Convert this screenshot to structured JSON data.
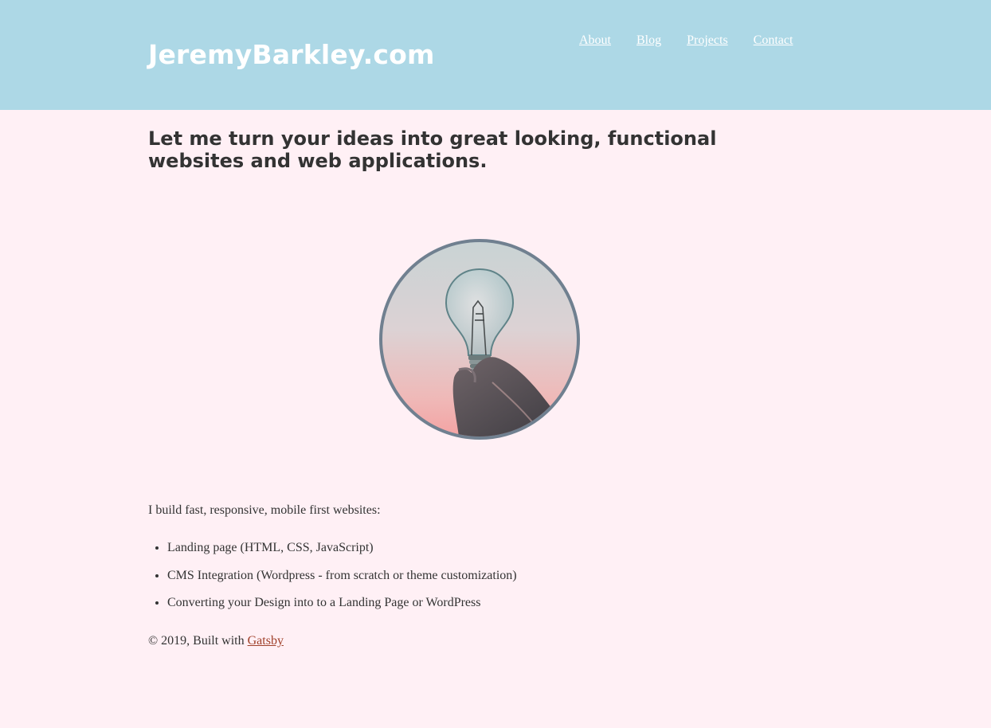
{
  "header": {
    "site_title": "JeremyBarkley.com",
    "nav": [
      {
        "label": "About"
      },
      {
        "label": "Blog"
      },
      {
        "label": "Projects"
      },
      {
        "label": "Contact"
      }
    ]
  },
  "main": {
    "headline": "Let me turn your ideas into great looking, functional websites and web applications.",
    "hero_image": {
      "icon": "lightbulb-in-hand-icon"
    },
    "intro": "I build fast, responsive, mobile first websites:",
    "services": [
      "Landing page (HTML, CSS, JavaScript)",
      "CMS Integration (Wordpress - from scratch or theme customization)",
      "Converting your Design into to a Landing Page or WordPress"
    ]
  },
  "footer": {
    "copyright": "© 2019, Built with",
    "link_label": "Gatsby"
  },
  "colors": {
    "header_bg": "#add8e6",
    "page_bg": "#fff0f5",
    "text": "#333333",
    "link": "#a0402a",
    "image_border": "#708090"
  }
}
